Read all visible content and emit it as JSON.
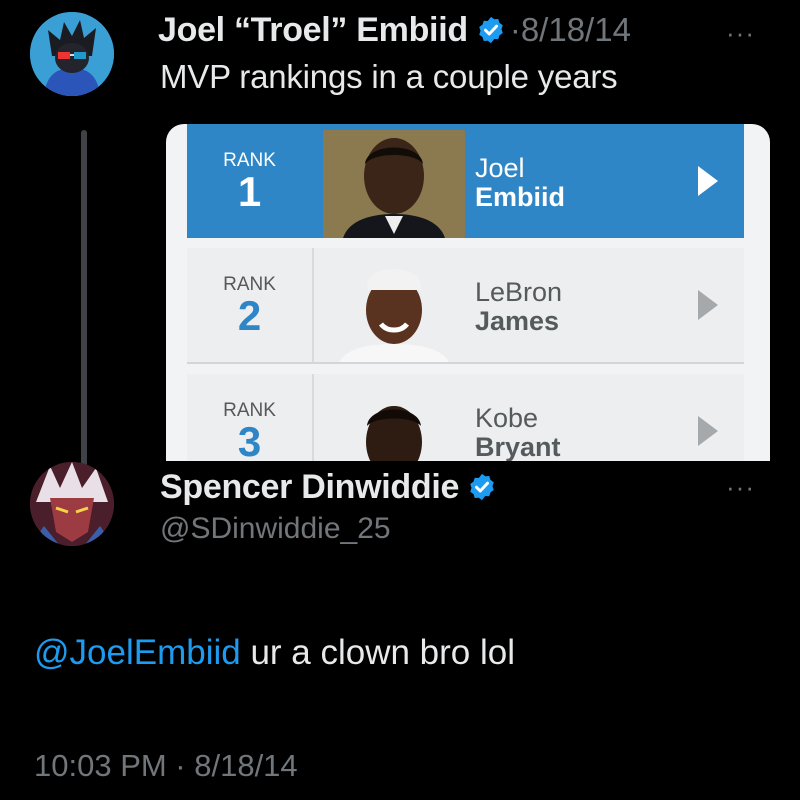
{
  "tweet1": {
    "display_name": "Joel “Troel” Embiid",
    "date": "·8/18/14",
    "more_label": "···",
    "text": "MVP rankings in a couple years",
    "avatar_icon": "cartoon-avatar-icon",
    "rankings": [
      {
        "rank_label": "RANK",
        "rank": "1",
        "first": "Joel",
        "last": "Embiid",
        "selected": true
      },
      {
        "rank_label": "RANK",
        "rank": "2",
        "first": "LeBron",
        "last": "James",
        "selected": false
      },
      {
        "rank_label": "RANK",
        "rank": "3",
        "first": "Kobe",
        "last": "Bryant",
        "selected": false
      }
    ]
  },
  "tweet2": {
    "display_name": "Spencer Dinwiddie",
    "handle": "@SDinwiddie_25",
    "more_label": "···",
    "mention": "@JoelEmbiid",
    "text": " ur a clown bro lol",
    "timestamp": "10:03 PM · 8/18/14",
    "avatar_icon": "anime-avatar-icon"
  },
  "colors": {
    "background": "#000000",
    "text": "#e7e9ea",
    "secondary": "#71767b",
    "link": "#1d9bf0",
    "verified": "#1d9bf0",
    "rank_highlight": "#2f86c6"
  }
}
